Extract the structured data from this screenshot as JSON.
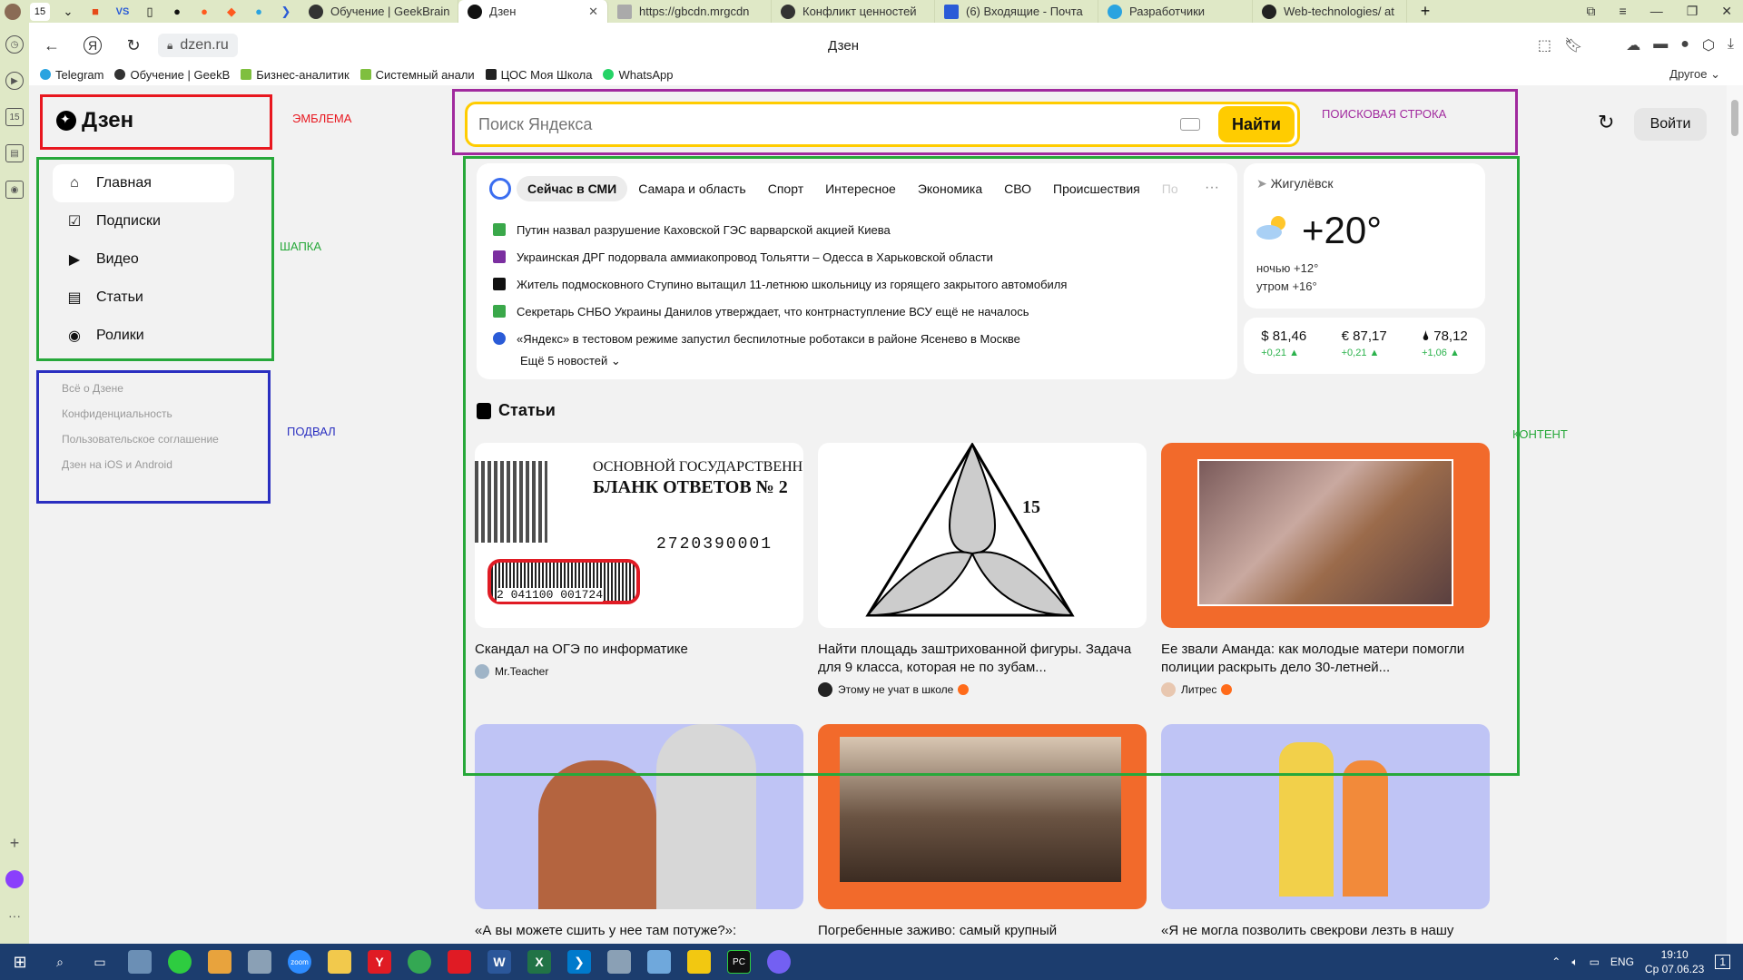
{
  "browser": {
    "tab_counter": "15",
    "tabs": [
      {
        "title": "Обучение | GeekBrain",
        "color": "#333"
      },
      {
        "title": "Дзен",
        "color": "#111",
        "active": true
      },
      {
        "title": "https://gbcdn.mrgcdn",
        "color": "#888"
      },
      {
        "title": "Конфликт ценностей",
        "color": "#333"
      },
      {
        "title": "(6) Входящие - Почта",
        "color": "#2a5bd7"
      },
      {
        "title": "Разработчики",
        "color": "#2aa3e0"
      },
      {
        "title": "Web-technologies/ at",
        "color": "#222"
      }
    ],
    "url": "dzen.ru",
    "page_title": "Дзен",
    "bookmarks": [
      {
        "label": "Telegram",
        "color": "#2aa3e0"
      },
      {
        "label": "Обучение | GeekB",
        "color": "#333"
      },
      {
        "label": "Бизнес-аналитик",
        "color": "#7fbf3f"
      },
      {
        "label": "Системный анали",
        "color": "#7fbf3f"
      },
      {
        "label": "ЦОС Моя Школа",
        "color": "#222"
      },
      {
        "label": "WhatsApp",
        "color": "#25d366"
      }
    ],
    "bookmarks_other": "Другое"
  },
  "sidebar_strip": {
    "badge": "15"
  },
  "annotations": {
    "logo": "ЭМБЛЕМА",
    "search": "ПОИСКОВАЯ СТРОКА",
    "header": "ШАПКА",
    "footer": "ПОДВАЛ",
    "content": "КОНТЕНТ"
  },
  "colors": {
    "logo_box": "#e8171f",
    "search_box": "#a12a9e",
    "nav_box": "#27a83a",
    "footer_box": "#2a2fc0",
    "content_box": "#27a83a"
  },
  "logo": {
    "text": "Дзен"
  },
  "nav": [
    {
      "label": "Главная",
      "icon": "home-icon"
    },
    {
      "label": "Подписки",
      "icon": "subscriptions-icon"
    },
    {
      "label": "Видео",
      "icon": "video-icon"
    },
    {
      "label": "Статьи",
      "icon": "articles-icon"
    },
    {
      "label": "Ролики",
      "icon": "clips-icon"
    }
  ],
  "footer_links": [
    "Всё о Дзене",
    "Конфиденциальность",
    "Пользовательское соглашение",
    "Дзен на iOS и Android"
  ],
  "search": {
    "placeholder": "Поиск Яндекса",
    "button": "Найти"
  },
  "login": "Войти",
  "news": {
    "tabs": [
      "Сейчас в СМИ",
      "Самара и область",
      "Спорт",
      "Интересное",
      "Экономика",
      "СВО",
      "Происшествия",
      "По"
    ],
    "more": "···",
    "items": [
      {
        "text": "Путин назвал разрушение Каховской ГЭС варварской акцией Киева",
        "color": "#3aa84a"
      },
      {
        "text": "Украинская ДРГ подорвала аммиакопровод Тольятти – Одесса в Харьковской области",
        "color": "#7b2fa0"
      },
      {
        "text": "Житель подмосковного Ступино вытащил 11-летнюю школьницу из горящего закрытого автомобиля",
        "color": "#111"
      },
      {
        "text": "Секретарь СНБО Украины Данилов утверждает, что контрнаступление ВСУ ещё не началось",
        "color": "#3aa84a"
      },
      {
        "text": "«Яндекс» в тестовом режиме запустил беспилотные роботакси в районе Ясенево в Москве",
        "color": "#2a5bd7"
      }
    ],
    "expand": "Ещё 5 новостей"
  },
  "weather": {
    "location": "Жигулёвск",
    "temp": "+20°",
    "night": "ночью +12°",
    "morning": "утром +16°"
  },
  "rates": [
    {
      "value": "$ 81,46",
      "change": "+0,21 ▲"
    },
    {
      "value": "€ 87,17",
      "change": "+0,21 ▲"
    },
    {
      "value": "🌢 78,12",
      "change": "+1,06 ▲"
    }
  ],
  "articles": {
    "heading": "Статьи",
    "cards": [
      {
        "title": "Скандал на ОГЭ по информатике",
        "source": "Mr.Teacher",
        "verified": false
      },
      {
        "title": "Найти площадь заштрихованной фигуры. Задача для 9 класса, которая не по зубам...",
        "source": "Этому не учат в школе",
        "verified": true
      },
      {
        "title": "Ее звали Аманда: как молодые матери помогли полиции раскрыть дело 30-летней...",
        "source": "Литрес",
        "verified": true
      },
      {
        "title": "«А вы можете сшить у нее там потуже?»:",
        "source": "",
        "verified": false
      },
      {
        "title": "Погребенные заживо: самый крупный",
        "source": "",
        "verified": false
      },
      {
        "title": "«Я не могла позволить свекрови лезть в нашу",
        "source": "",
        "verified": false
      }
    ],
    "thumb1_text": [
      "ОСНОВНОЙ ГОСУДАРСТВЕНН",
      "БЛАНК ОТВЕТОВ № 2",
      "2720390001",
      "2 041100 001724"
    ],
    "thumb2_label": "15"
  },
  "taskbar": {
    "lang": "ENG",
    "time": "19:10",
    "date": "Ср 07.06.23",
    "notif": "1"
  }
}
